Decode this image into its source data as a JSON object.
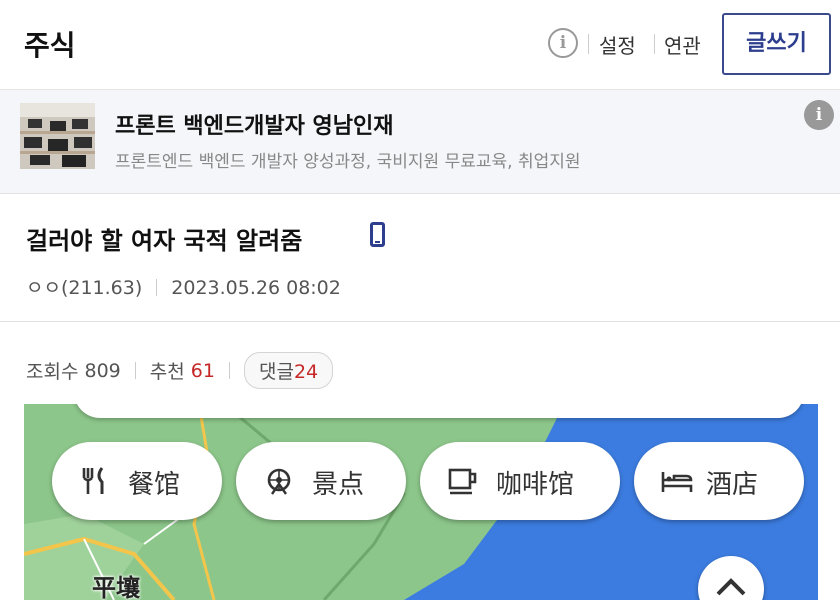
{
  "header": {
    "title": "주식",
    "settings_label": "설정",
    "related_label": "연관",
    "write_label": "글쓰기",
    "info_icon": "info-icon"
  },
  "ad": {
    "headline": "프론트 백엔드개발자 영남인재",
    "description": "프론트엔드 백엔드 개발자 양성과정, 국비지원 무료교육, 취업지원",
    "info_icon": "info-icon"
  },
  "post": {
    "title": "걸러야 할 여자 국적 알려줌",
    "device_icon": "mobile-icon",
    "author": "ㅇㅇ(211.63)",
    "datetime": "2023.05.26 08:02",
    "views_label": "조회수",
    "views": "809",
    "likes_label": "추천",
    "likes": "61",
    "comments_label": "댓글",
    "comments": "24"
  },
  "map_image": {
    "chips": [
      {
        "label": "餐馆",
        "icon": "restaurant-icon"
      },
      {
        "label": "景点",
        "icon": "attraction-icon"
      },
      {
        "label": "咖啡馆",
        "icon": "cafe-icon"
      },
      {
        "label": "酒店",
        "icon": "hotel-icon"
      }
    ],
    "city_label": "平壤",
    "expand_icon": "chevron-up-icon",
    "colors": {
      "sea": "#3c7ce0",
      "land": "#8cc68a",
      "road": "#f3c64b"
    }
  }
}
